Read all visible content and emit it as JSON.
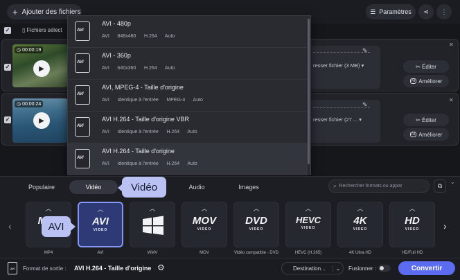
{
  "toolbar": {
    "add_files": "Ajouter des fichiers",
    "settings": "Paramètres"
  },
  "files_bar": {
    "selected": "Fichiers sélect"
  },
  "files": [
    {
      "duration": "00:00:19",
      "compress": "resser fichier (3 MB)",
      "edit": "Éditer",
      "improve": "Améliorer"
    },
    {
      "duration": "00:00:24",
      "compress": "resser fichier (27 ...",
      "edit": "Éditer",
      "improve": "Améliorer"
    }
  ],
  "format_menu": [
    {
      "icon": "AVI",
      "title": "AVI - 480p",
      "meta": "AVI      848x480      H.264      Auto"
    },
    {
      "icon": "AVI",
      "title": "AVI - 360p",
      "meta": "AVI      640x360      H.264      Auto"
    },
    {
      "icon": "AVI",
      "title": "AVI, MPEG-4 - Taille d'origine",
      "meta": "AVI      Identique à l'entrée      MPEG-4      Auto"
    },
    {
      "icon": "AVI",
      "title": "AVI H.264 - Taille d'origine VBR",
      "meta": "AVI      Identique à l'entrée      H.264      Auto"
    },
    {
      "icon": "AVI",
      "title": "AVI H.264 - Taille d'origine",
      "meta": "AVI      Identique à l'entrée      H.264      Auto"
    }
  ],
  "tabs": {
    "popular": "Populaire",
    "video": "Vidéo",
    "audio": "Audio",
    "images": "Images"
  },
  "tooltip_video": "Vidéo",
  "tooltip_avi": "AVI",
  "search": {
    "placeholder": "Rechercher formats ou appar"
  },
  "formats": [
    {
      "logo": "MP4",
      "sub": "",
      "label": "MP4"
    },
    {
      "logo": "AVI",
      "sub": "VIDEO",
      "label": "AVI"
    },
    {
      "logo": "",
      "sub": "",
      "label": "WMV"
    },
    {
      "logo": "MOV",
      "sub": "VIDEO",
      "label": "MOV"
    },
    {
      "logo": "DVD",
      "sub": "VIDEO",
      "label": "Vidéo compatible - DVD"
    },
    {
      "logo": "HEVC",
      "sub": "VIDEO",
      "label": "HEVC (H.265)"
    },
    {
      "logo": "4K",
      "sub": "VIDEO",
      "label": "4K Ultra HD"
    },
    {
      "logo": "HD",
      "sub": "VIDEO",
      "label": "HD/Full HD"
    }
  ],
  "output": {
    "label": "Format de sortie :",
    "value": "AVI H.264 - Taille d'origine",
    "destination": "Destination...",
    "merge": "Fusionner :",
    "convert": "Convertir",
    "badge": "AVI"
  }
}
